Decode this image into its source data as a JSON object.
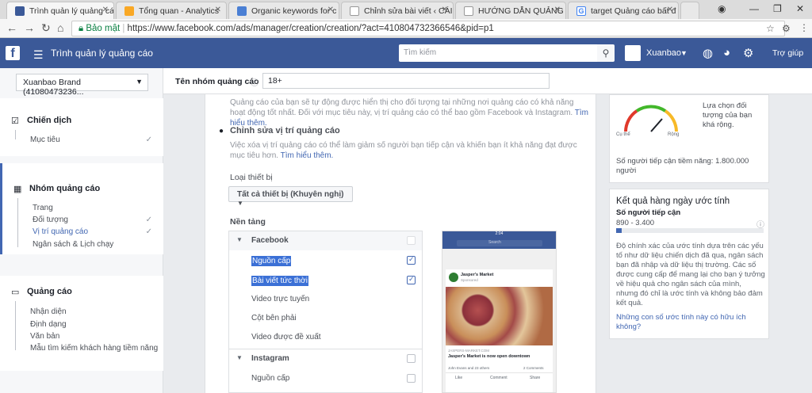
{
  "browser": {
    "tabs": [
      {
        "title": "Trình quản lý quảng cáo",
        "active": true
      },
      {
        "title": "Tổng quan - Analytics"
      },
      {
        "title": "Organic keywords for c"
      },
      {
        "title": "Chỉnh sửa bài viết ‹ CÁI"
      },
      {
        "title": "HƯỚNG DẪN QUẢNG"
      },
      {
        "title": "target Quảng cáo bất đ"
      }
    ],
    "security_label": "Bảo mật",
    "url": "https://www.facebook.com/ads/manager/creation/creation/?act=410804732366546&pid=p1"
  },
  "fb": {
    "logo": "f",
    "title": "Trình quản lý quảng cáo",
    "search_placeholder": "Tìm kiếm",
    "account_name": "Xuanbao",
    "help": "Trợ giúp"
  },
  "sidebar": {
    "brand": "Xuanbao Brand (41080473236...",
    "campaign": {
      "title": "Chiến dịch",
      "items": [
        "Mục tiêu"
      ]
    },
    "adset": {
      "title": "Nhóm quảng cáo",
      "items": [
        "Trang",
        "Đối tượng",
        "Vị trí quảng cáo",
        "Ngân sách & Lịch chạy"
      ]
    },
    "ad": {
      "title": "Quảng cáo",
      "items": [
        "Nhận diện",
        "Định dạng",
        "Văn bản",
        "Mẫu tìm kiếm khách hàng tiềm năng"
      ]
    }
  },
  "form": {
    "adset_name_label": "Tên nhóm quảng cáo",
    "adset_name_value": "18+"
  },
  "placement": {
    "auto_desc": "Quảng cáo của bạn sẽ tự động được hiển thị cho đối tượng tại những nơi quảng cáo có khả năng hoạt động tốt nhất. Đối với mục tiêu này, vị trí quảng cáo có thể bao gồm Facebook và Instagram.",
    "auto_link": "Tìm hiểu thêm.",
    "edit_title": "Chỉnh sửa vị trí quảng cáo",
    "edit_desc": "Việc xóa vị trí quảng cáo có thể làm giảm số người bạn tiếp cận và khiến bạn ít khả năng đạt được mục tiêu hơn.",
    "edit_link": "Tìm hiểu thêm.",
    "device_label": "Loại thiết bị",
    "device_value": "Tất cả thiết bị (Khuyên nghị)",
    "platform_label": "Nền tảng",
    "platforms": {
      "facebook": "Facebook",
      "fb_items": [
        "Nguồn cấp",
        "Bài viết tức thời",
        "Video trực tuyến",
        "Cột bên phải",
        "Video được đề xuất"
      ],
      "instagram": "Instagram",
      "ig_items": [
        "Nguồn cấp"
      ]
    },
    "preview": {
      "time": "2:04",
      "search": "Search",
      "page": "Jasper's Market",
      "sponsored": "Sponsored",
      "domain": "JASPERS-MARKET.COM",
      "headline": "Jasper's Market is now open downtown",
      "reactions": "John Evans and 23 others",
      "comments": "2 Comments",
      "actions": [
        "Like",
        "Comment",
        "Share"
      ]
    }
  },
  "audience": {
    "desc": "Lựa chọn đối tượng của bạn khá rộng.",
    "left": "Cụ thể",
    "right": "Rộng",
    "reach": "Số người tiếp cận tiềm năng: 1.800.000 người"
  },
  "daily": {
    "title": "Kết quả hàng ngày ước tính",
    "reach_label": "Số người tiếp cận",
    "reach_range": "890 - 3.400",
    "reach_fill": 0.04,
    "desc": "Độ chính xác của ước tính dựa trên các yếu tố như dữ liệu chiến dịch đã qua, ngân sách bạn đã nhập và dữ liệu thị trường. Các số được cung cấp để mang lại cho bạn ý tưởng về hiệu quả cho ngân sách của mình, nhưng đó chỉ là ước tính và không bảo đảm kết quả.",
    "question": "Những con số ước tính này có hữu ích không?"
  }
}
